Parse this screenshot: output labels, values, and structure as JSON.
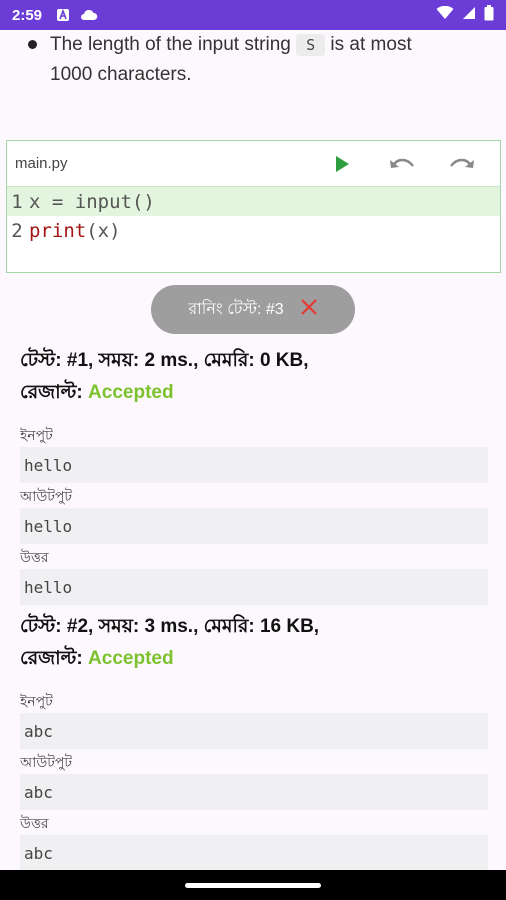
{
  "status_bar": {
    "time": "2:59"
  },
  "problem": {
    "text_before": "The length of the input string",
    "code": "S",
    "text_after": "is at most",
    "line2": "1000 characters."
  },
  "editor": {
    "file_name": "main.py",
    "lines": [
      {
        "num": "1",
        "code": "x = input()"
      },
      {
        "num": "2",
        "keyword": "print",
        "rest": "(x)"
      }
    ]
  },
  "run_status": {
    "label": "রানিং টেস্ট: #3"
  },
  "tests": [
    {
      "header_prefix": "টেস্ট: #1, সময়: 2 ms., মেমরি: 0 KB,",
      "result_label": "রেজাল্ট:",
      "result": "Accepted",
      "input_label": "ইনপুট",
      "input": "hello",
      "output_label": "আউটপুট",
      "output": "hello",
      "answer_label": "উত্তর",
      "answer": "hello"
    },
    {
      "header_prefix": "টেস্ট: #2, সময়: 3 ms., মেমরি: 16 KB,",
      "result_label": "রেজাল্ট:",
      "result": "Accepted",
      "input_label": "ইনপুট",
      "input": "abc",
      "output_label": "আউটপুট",
      "output": "abc",
      "answer_label": "উত্তর",
      "answer": "abc"
    }
  ],
  "colors": {
    "status_bar": "#6b3dd6",
    "accepted": "#7cc22e",
    "run": "#2e9e3e",
    "cancel": "#e53935"
  }
}
